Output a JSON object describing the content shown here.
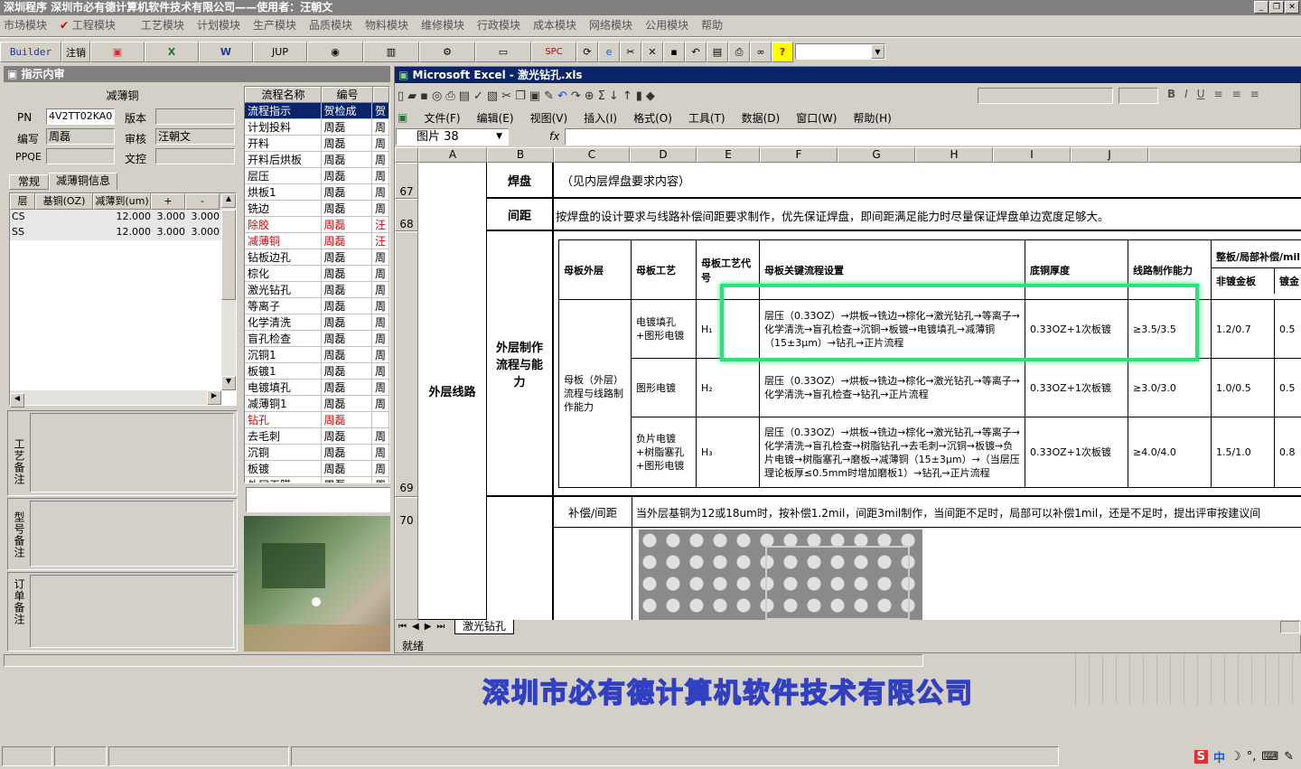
{
  "app": {
    "title": "深圳程序   深圳市必有德计算机软件技术有限公司——使用者：汪朝文",
    "menus": [
      "市场模块",
      "工程模块",
      "工艺模块",
      "计划模块",
      "生产模块",
      "品质模块",
      "物料模块",
      "维修模块",
      "行政模块",
      "成本模块",
      "网络模块",
      "公用模块",
      "帮助"
    ],
    "toolbar": {
      "builder": "Builder",
      "logout": "注销",
      "jup": "JUP",
      "spc": "SPC"
    },
    "company_banner": "深圳市必有德计算机软件技术有限公司"
  },
  "left_panel": {
    "title": "指示内审",
    "header": "减薄铜",
    "fields": {
      "pn_label": "PN",
      "pn": "4V2TT02KA0",
      "version_label": "版本",
      "version": "",
      "author_label": "编写",
      "author": "周磊",
      "reviewer_label": "审核",
      "reviewer": "汪朝文",
      "ppqe_label": "PPQE",
      "ppqe": "",
      "controller_label": "文控",
      "controller": ""
    },
    "tabs": [
      "常规",
      "减薄铜信息"
    ],
    "grid": {
      "headers": [
        "层",
        "基铜(OZ)",
        "减薄到(um)",
        "+",
        "-"
      ],
      "rows": [
        [
          "CS",
          "",
          "12.000",
          "3.000",
          "3.000"
        ],
        [
          "SS",
          "",
          "12.000",
          "3.000",
          "3.000"
        ]
      ]
    },
    "notes": [
      "工艺备注",
      "型号备注",
      "订单备注"
    ]
  },
  "flow_list": {
    "headers": [
      "流程名称",
      "编号",
      ""
    ],
    "rows": [
      {
        "name": "流程指示",
        "code": "贺检成",
        "x": "贺",
        "style": "sel"
      },
      {
        "name": "计划投料",
        "code": "周磊",
        "x": "周",
        "style": ""
      },
      {
        "name": "开料",
        "code": "周磊",
        "x": "周",
        "style": ""
      },
      {
        "name": "开料后烘板",
        "code": "周磊",
        "x": "周",
        "style": ""
      },
      {
        "name": "层压",
        "code": "周磊",
        "x": "周",
        "style": ""
      },
      {
        "name": "烘板1",
        "code": "周磊",
        "x": "周",
        "style": ""
      },
      {
        "name": "铣边",
        "code": "周磊",
        "x": "周",
        "style": ""
      },
      {
        "name": "除胶",
        "code": "周磊",
        "x": "汪",
        "style": "red"
      },
      {
        "name": "减薄铜",
        "code": "周磊",
        "x": "汪",
        "style": "red"
      },
      {
        "name": "钻板边孔",
        "code": "周磊",
        "x": "周",
        "style": ""
      },
      {
        "name": "棕化",
        "code": "周磊",
        "x": "周",
        "style": ""
      },
      {
        "name": "激光钻孔",
        "code": "周磊",
        "x": "周",
        "style": ""
      },
      {
        "name": "等离子",
        "code": "周磊",
        "x": "周",
        "style": ""
      },
      {
        "name": "化学清洗",
        "code": "周磊",
        "x": "周",
        "style": ""
      },
      {
        "name": "盲孔检查",
        "code": "周磊",
        "x": "周",
        "style": ""
      },
      {
        "name": "沉铜1",
        "code": "周磊",
        "x": "周",
        "style": ""
      },
      {
        "name": "板镀1",
        "code": "周磊",
        "x": "周",
        "style": ""
      },
      {
        "name": "电镀填孔",
        "code": "周磊",
        "x": "周",
        "style": ""
      },
      {
        "name": "减薄铜1",
        "code": "周磊",
        "x": "周",
        "style": ""
      },
      {
        "name": "钻孔",
        "code": "周磊",
        "x": "",
        "style": "red"
      },
      {
        "name": "去毛刺",
        "code": "周磊",
        "x": "周",
        "style": ""
      },
      {
        "name": "沉铜",
        "code": "周磊",
        "x": "周",
        "style": ""
      },
      {
        "name": "板镀",
        "code": "周磊",
        "x": "周",
        "style": ""
      },
      {
        "name": "外层干膜",
        "code": "周磊",
        "x": "周",
        "style": ""
      }
    ]
  },
  "excel": {
    "title": "Microsoft Excel - 激光钻孔.xls",
    "menus": [
      "文件(F)",
      "编辑(E)",
      "视图(V)",
      "插入(I)",
      "格式(O)",
      "工具(T)",
      "数据(D)",
      "窗口(W)",
      "帮助(H)"
    ],
    "namebox": "图片 38",
    "fx": "fx",
    "columns": [
      "A",
      "B",
      "C",
      "D",
      "E",
      "F",
      "G",
      "H",
      "I",
      "J"
    ],
    "rows": [
      "67",
      "68",
      "69",
      "70"
    ],
    "sheet_tab": "激光钻孔",
    "status": "就绪",
    "cells": {
      "r67_label": "焊盘",
      "r67_text": "（见内层焊盘要求内容）",
      "r68_label": "间距",
      "r68_text": "按焊盘的设计要求与线路补偿间距要求制作，优先保证焊盘，即间距满足能力时尽量保证焊盘单边宽度足够大。",
      "outer_line": "外层线路",
      "r69_label": "外层制作流程与能力",
      "comp_label": "补偿/间距",
      "comp_text": "当外层基铜为12或18um时，按补偿1.2mil，间距3mil制作，当间距不足时，局部可以补偿1mil，还是不足时，提出评审按建议间"
    },
    "inner_table": {
      "headers": [
        "母板外层",
        "母板工艺",
        "母板工艺代号",
        "母板关键流程设置",
        "底铜厚度",
        "线路制作能力",
        "整板/局部补偿/mil"
      ],
      "subheaders": [
        "非镀金板",
        "镀金"
      ],
      "group_label": "母板（外层）流程与线路制作能力",
      "rows": [
        {
          "proc": "电镀填孔+图形电镀",
          "code": "H₁",
          "flow": "层压（0.33OZ）→烘板→铣边→棕化→激光钻孔→等离子→化学清洗→盲孔检查→沉铜→板镀→电镀填孔→减薄铜（15±3μm）→钻孔→正片流程",
          "cu": "0.33OZ+1次板镀",
          "cap": "≥3.5/3.5",
          "nongold": "1.2/0.7",
          "gold": "0.5"
        },
        {
          "proc": "图形电镀",
          "code": "H₂",
          "flow": "层压（0.33OZ）→烘板→铣边→棕化→激光钻孔→等离子→化学清洗→盲孔检查→钻孔→正片流程",
          "cu": "0.33OZ+1次板镀",
          "cap": "≥3.0/3.0",
          "nongold": "1.0/0.5",
          "gold": "0.5"
        },
        {
          "proc": "负片电镀+树脂塞孔+图形电镀",
          "code": "H₃",
          "flow": "层压（0.33OZ）→烘板→铣边→棕化→激光钻孔→等离子→化学清洗→盲孔检查→树脂钻孔→去毛刺→沉铜→板镀→负片电镀→树脂塞孔→磨板→减薄铜（15±3μm）→（当层压理论板厚≤0.5mm时增加磨板1）→钻孔→正片流程",
          "cu": "0.33OZ+1次板镀",
          "cap": "≥4.0/4.0",
          "nongold": "1.5/1.0",
          "gold": "0.8"
        }
      ]
    }
  }
}
